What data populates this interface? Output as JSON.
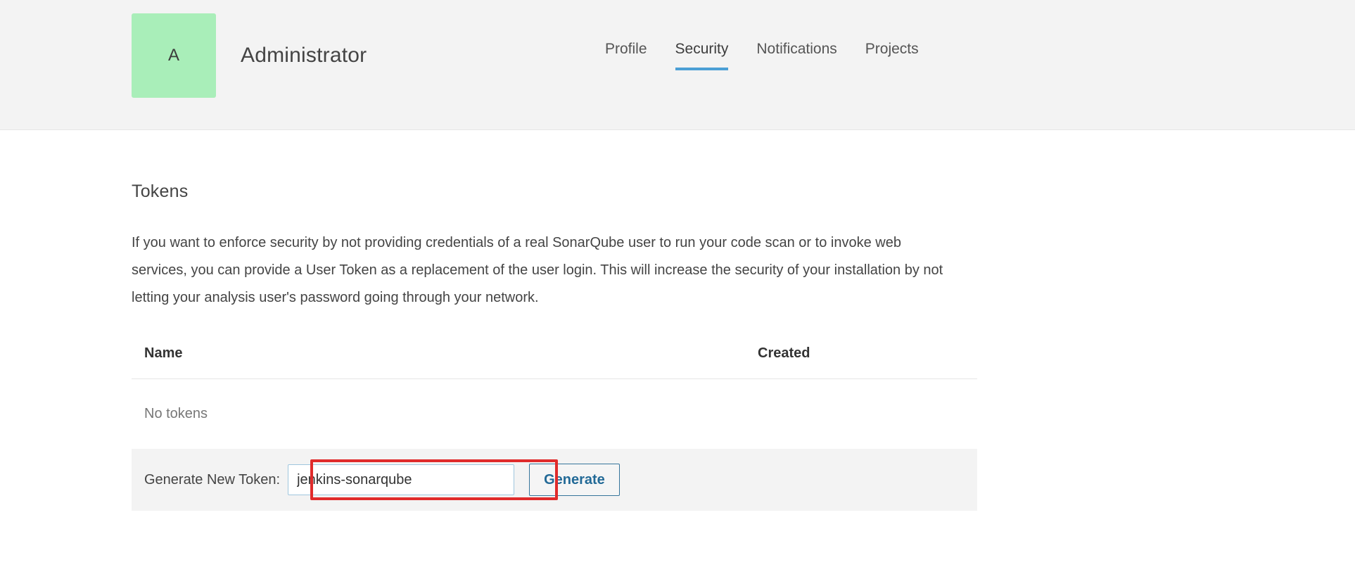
{
  "header": {
    "avatar_initial": "A",
    "user_name": "Administrator",
    "tabs": [
      {
        "label": "Profile",
        "active": false
      },
      {
        "label": "Security",
        "active": true
      },
      {
        "label": "Notifications",
        "active": false
      },
      {
        "label": "Projects",
        "active": false
      }
    ]
  },
  "main": {
    "section_title": "Tokens",
    "intro_text": "If you want to enforce security by not providing credentials of a real SonarQube user to run your code scan or to invoke web services, you can provide a User Token as a replacement of the user login. This will increase the security of your installation by not letting your analysis user's password going through your network.",
    "table": {
      "columns": [
        "Name",
        "Created"
      ],
      "rows": [],
      "empty_message": "No tokens"
    },
    "generate": {
      "label": "Generate New Token:",
      "input_value": "jenkins-sonarqube",
      "input_placeholder": "",
      "button_label": "Generate"
    }
  },
  "colors": {
    "accent_blue": "#4b9fd5",
    "header_bg": "#f3f3f3",
    "avatar_green": "#a9eeb9",
    "annotation_red": "#e02b2b",
    "button_text": "#236a97"
  }
}
